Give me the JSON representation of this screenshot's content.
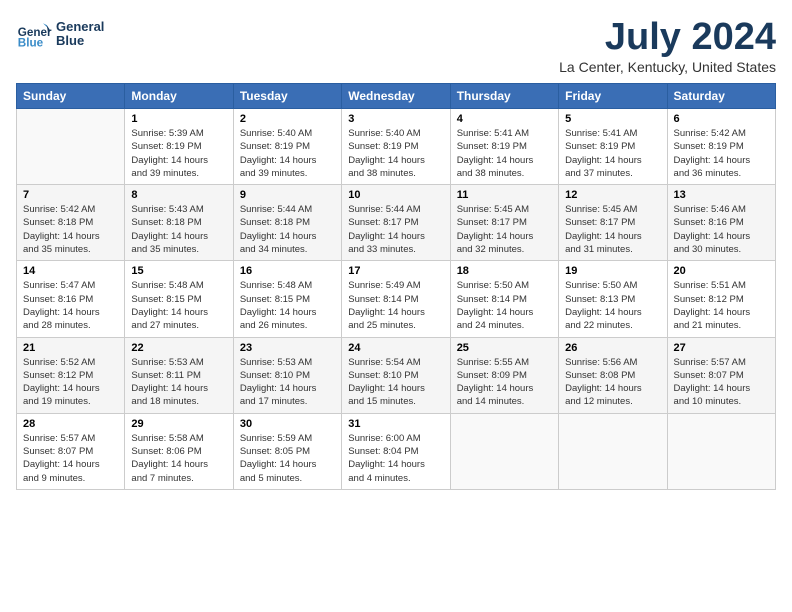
{
  "header": {
    "logo_line1": "General",
    "logo_line2": "Blue",
    "title": "July 2024",
    "subtitle": "La Center, Kentucky, United States"
  },
  "days_of_week": [
    "Sunday",
    "Monday",
    "Tuesday",
    "Wednesday",
    "Thursday",
    "Friday",
    "Saturday"
  ],
  "weeks": [
    [
      {
        "num": "",
        "info": ""
      },
      {
        "num": "1",
        "info": "Sunrise: 5:39 AM\nSunset: 8:19 PM\nDaylight: 14 hours\nand 39 minutes."
      },
      {
        "num": "2",
        "info": "Sunrise: 5:40 AM\nSunset: 8:19 PM\nDaylight: 14 hours\nand 39 minutes."
      },
      {
        "num": "3",
        "info": "Sunrise: 5:40 AM\nSunset: 8:19 PM\nDaylight: 14 hours\nand 38 minutes."
      },
      {
        "num": "4",
        "info": "Sunrise: 5:41 AM\nSunset: 8:19 PM\nDaylight: 14 hours\nand 38 minutes."
      },
      {
        "num": "5",
        "info": "Sunrise: 5:41 AM\nSunset: 8:19 PM\nDaylight: 14 hours\nand 37 minutes."
      },
      {
        "num": "6",
        "info": "Sunrise: 5:42 AM\nSunset: 8:19 PM\nDaylight: 14 hours\nand 36 minutes."
      }
    ],
    [
      {
        "num": "7",
        "info": "Sunrise: 5:42 AM\nSunset: 8:18 PM\nDaylight: 14 hours\nand 35 minutes."
      },
      {
        "num": "8",
        "info": "Sunrise: 5:43 AM\nSunset: 8:18 PM\nDaylight: 14 hours\nand 35 minutes."
      },
      {
        "num": "9",
        "info": "Sunrise: 5:44 AM\nSunset: 8:18 PM\nDaylight: 14 hours\nand 34 minutes."
      },
      {
        "num": "10",
        "info": "Sunrise: 5:44 AM\nSunset: 8:17 PM\nDaylight: 14 hours\nand 33 minutes."
      },
      {
        "num": "11",
        "info": "Sunrise: 5:45 AM\nSunset: 8:17 PM\nDaylight: 14 hours\nand 32 minutes."
      },
      {
        "num": "12",
        "info": "Sunrise: 5:45 AM\nSunset: 8:17 PM\nDaylight: 14 hours\nand 31 minutes."
      },
      {
        "num": "13",
        "info": "Sunrise: 5:46 AM\nSunset: 8:16 PM\nDaylight: 14 hours\nand 30 minutes."
      }
    ],
    [
      {
        "num": "14",
        "info": "Sunrise: 5:47 AM\nSunset: 8:16 PM\nDaylight: 14 hours\nand 28 minutes."
      },
      {
        "num": "15",
        "info": "Sunrise: 5:48 AM\nSunset: 8:15 PM\nDaylight: 14 hours\nand 27 minutes."
      },
      {
        "num": "16",
        "info": "Sunrise: 5:48 AM\nSunset: 8:15 PM\nDaylight: 14 hours\nand 26 minutes."
      },
      {
        "num": "17",
        "info": "Sunrise: 5:49 AM\nSunset: 8:14 PM\nDaylight: 14 hours\nand 25 minutes."
      },
      {
        "num": "18",
        "info": "Sunrise: 5:50 AM\nSunset: 8:14 PM\nDaylight: 14 hours\nand 24 minutes."
      },
      {
        "num": "19",
        "info": "Sunrise: 5:50 AM\nSunset: 8:13 PM\nDaylight: 14 hours\nand 22 minutes."
      },
      {
        "num": "20",
        "info": "Sunrise: 5:51 AM\nSunset: 8:12 PM\nDaylight: 14 hours\nand 21 minutes."
      }
    ],
    [
      {
        "num": "21",
        "info": "Sunrise: 5:52 AM\nSunset: 8:12 PM\nDaylight: 14 hours\nand 19 minutes."
      },
      {
        "num": "22",
        "info": "Sunrise: 5:53 AM\nSunset: 8:11 PM\nDaylight: 14 hours\nand 18 minutes."
      },
      {
        "num": "23",
        "info": "Sunrise: 5:53 AM\nSunset: 8:10 PM\nDaylight: 14 hours\nand 17 minutes."
      },
      {
        "num": "24",
        "info": "Sunrise: 5:54 AM\nSunset: 8:10 PM\nDaylight: 14 hours\nand 15 minutes."
      },
      {
        "num": "25",
        "info": "Sunrise: 5:55 AM\nSunset: 8:09 PM\nDaylight: 14 hours\nand 14 minutes."
      },
      {
        "num": "26",
        "info": "Sunrise: 5:56 AM\nSunset: 8:08 PM\nDaylight: 14 hours\nand 12 minutes."
      },
      {
        "num": "27",
        "info": "Sunrise: 5:57 AM\nSunset: 8:07 PM\nDaylight: 14 hours\nand 10 minutes."
      }
    ],
    [
      {
        "num": "28",
        "info": "Sunrise: 5:57 AM\nSunset: 8:07 PM\nDaylight: 14 hours\nand 9 minutes."
      },
      {
        "num": "29",
        "info": "Sunrise: 5:58 AM\nSunset: 8:06 PM\nDaylight: 14 hours\nand 7 minutes."
      },
      {
        "num": "30",
        "info": "Sunrise: 5:59 AM\nSunset: 8:05 PM\nDaylight: 14 hours\nand 5 minutes."
      },
      {
        "num": "31",
        "info": "Sunrise: 6:00 AM\nSunset: 8:04 PM\nDaylight: 14 hours\nand 4 minutes."
      },
      {
        "num": "",
        "info": ""
      },
      {
        "num": "",
        "info": ""
      },
      {
        "num": "",
        "info": ""
      }
    ]
  ]
}
